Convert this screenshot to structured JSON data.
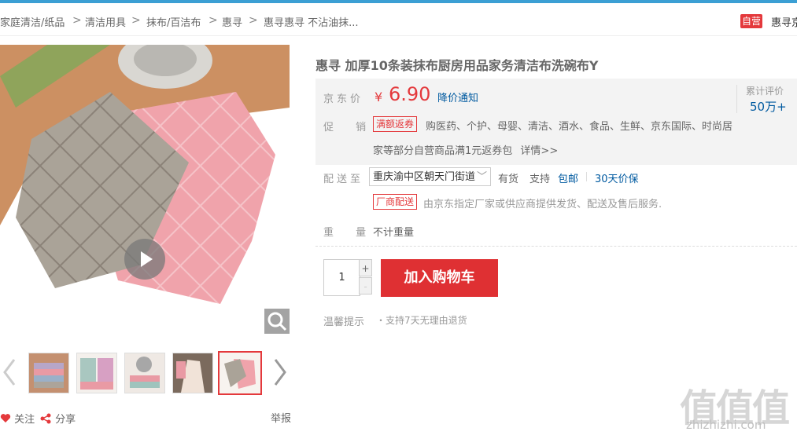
{
  "breadcrumb": {
    "items": [
      "家庭清洁/纸品",
      "清洁用具",
      "抹布/百洁布",
      "惠寻",
      "惠寻惠寻 不沾油抹..."
    ],
    "separator": ">"
  },
  "shop": {
    "badge": "自营",
    "name": "惠寻京"
  },
  "gallery": {
    "thumbnails": [
      "thumb-1",
      "thumb-2",
      "thumb-3",
      "thumb-4",
      "thumb-5"
    ],
    "active_index": 4
  },
  "actions": {
    "follow": "关注",
    "share": "分享",
    "report": "举报"
  },
  "product": {
    "title": "惠寻 加厚10条装抹布厨房用品家务清洁布洗碗布Y",
    "price_label": "京东价",
    "currency": "¥",
    "price": "6.90",
    "notify": "降价通知",
    "eval_label": "累计评价",
    "eval_count": "50万+",
    "promo_label": "促 销",
    "promo_tag": "满额返券",
    "promo_text_1": "购医药、个护、母婴、清洁、酒水、食品、生鲜、京东国际、时尚居",
    "promo_text_2": "家等部分自营商品满1元返券包",
    "promo_detail": "详情>>",
    "delivery_label": "配送至",
    "address": "重庆渝中区朝天门街道",
    "stock": "有货",
    "support": "支持",
    "free_ship": "包邮",
    "price_protect": "30天价保",
    "ship_tag": "厂商配送",
    "ship_text": "由京东指定厂家或供应商提供发货、配送及售后服务.",
    "weight_label": "重 量",
    "weight_value": "不计重量",
    "quantity": "1",
    "qty_plus": "+",
    "qty_minus": "-",
    "add_to_cart": "加入购物车",
    "tips_label": "温馨提示",
    "tips_value": "・支持7天无理由退货"
  },
  "watermark": {
    "brand": "值值值",
    "url": "zhizhizhi.com"
  },
  "colors": {
    "accent": "#e4393c",
    "link": "#005aa0",
    "topbar": "#3b9fd4"
  }
}
